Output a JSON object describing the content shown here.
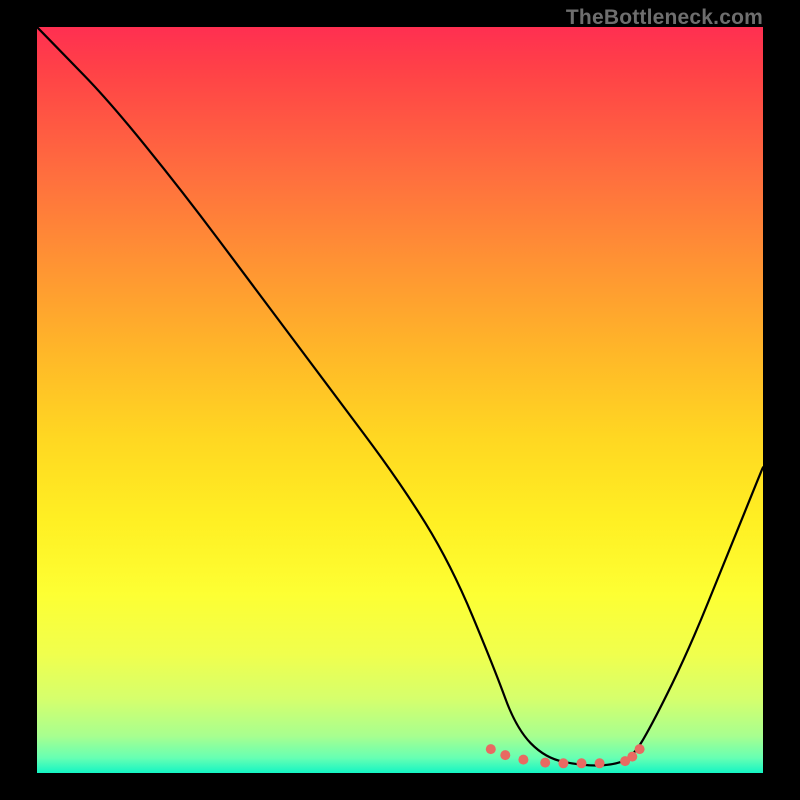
{
  "watermark": "TheBottleneck.com",
  "chart_data": {
    "type": "line",
    "title": "",
    "xlabel": "",
    "ylabel": "",
    "xlim": [
      0,
      100
    ],
    "ylim": [
      0,
      100
    ],
    "series": [
      {
        "name": "curve",
        "x": [
          0,
          3,
          10,
          20,
          30,
          40,
          50,
          57,
          63,
          66,
          70,
          75,
          79,
          82,
          85,
          90,
          95,
          100
        ],
        "values": [
          100,
          97,
          90,
          78,
          65,
          52,
          39,
          28,
          14,
          6,
          2,
          1,
          1,
          2,
          7,
          17,
          29,
          41
        ]
      }
    ],
    "markers": {
      "name": "highlight-dots",
      "color": "#e86a62",
      "x": [
        62.5,
        64.5,
        67,
        70,
        72.5,
        75,
        77.5,
        81,
        82,
        83
      ],
      "values": [
        3.2,
        2.4,
        1.8,
        1.4,
        1.3,
        1.3,
        1.3,
        1.6,
        2.2,
        3.2
      ]
    }
  }
}
